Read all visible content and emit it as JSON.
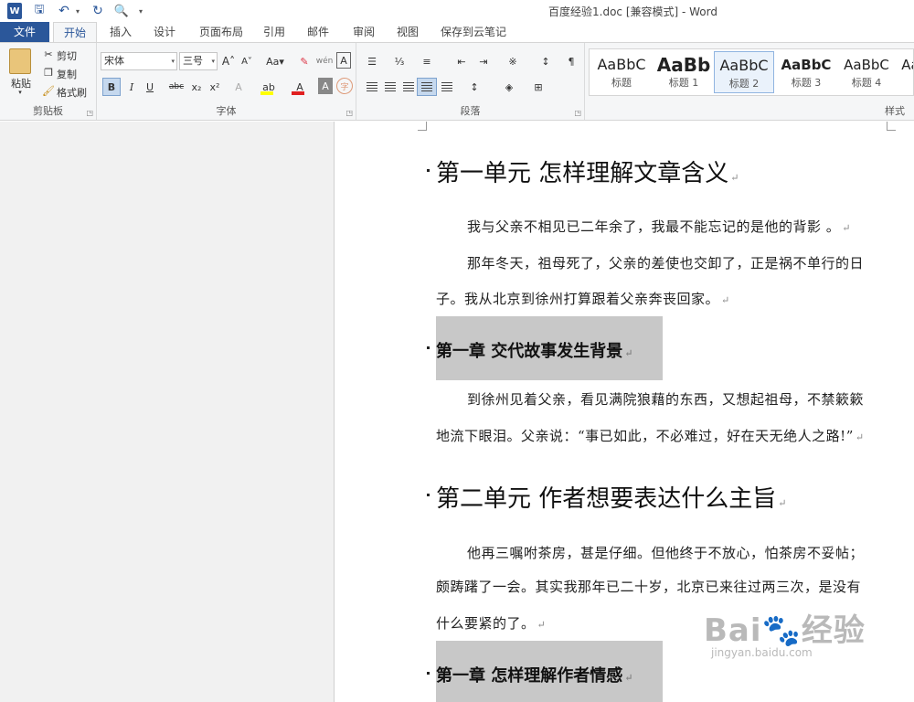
{
  "window": {
    "title": "百度经验1.doc [兼容模式] - Word",
    "logo": "W",
    "save_icon": "🖫",
    "undo_icon": "↶",
    "redo_icon": "↻",
    "preview_icon": "🔍",
    "dropdown": "▾"
  },
  "tabs": [
    "文件",
    "开始",
    "插入",
    "设计",
    "页面布局",
    "引用",
    "邮件",
    "审阅",
    "视图",
    "保存到云笔记"
  ],
  "ribbon": {
    "clipboard": {
      "label": "剪贴板",
      "paste": "粘贴",
      "cut": "剪切",
      "copy": "复制",
      "painter": "格式刷"
    },
    "font": {
      "label": "字体",
      "name": "宋体",
      "size": "三号",
      "grow": "A˄",
      "shrink": "A˅",
      "case": "Aa▾",
      "clear": "✎",
      "phonetic": "wén",
      "border_char": "A",
      "bold": "B",
      "italic": "I",
      "underline": "U",
      "strike": "abc",
      "sub": "x₂",
      "sup": "x²",
      "effect": "A",
      "highlight": "ab",
      "fontcolor": "A",
      "shade": "A",
      "enclose": "字"
    },
    "paragraph": {
      "label": "段落",
      "bullets": "☰",
      "numbering": "⅓",
      "multilevel": "≡",
      "decrease_indent": "⇤",
      "increase_indent": "⇥",
      "asian_layout": "※",
      "sort": "↕",
      "marks": "¶",
      "line_spacing": "↕",
      "shading": "◈",
      "borders": "⊞"
    },
    "styles": {
      "label": "样式",
      "items": [
        {
          "preview": "AaBbC",
          "name": "标题"
        },
        {
          "preview": "AaBb",
          "name": "标题 1"
        },
        {
          "preview": "AaBbC",
          "name": "标题 2"
        },
        {
          "preview": "AaBbC",
          "name": "标题 3"
        },
        {
          "preview": "AaBbC",
          "name": "标题 4"
        },
        {
          "preview": "Aa",
          "name": ""
        }
      ]
    }
  },
  "document": {
    "unit1_heading": "第一单元    怎样理解文章含义",
    "p1": "我与父亲不相见已二年余了，我最不能忘记的是他的背影 。",
    "p2_line1": "那年冬天，祖母死了，父亲的差使也交卸了，正是祸不单行的日",
    "p2_line2": "子。我从北京到徐州打算跟着父亲奔丧回家。",
    "chapter1_heading": "第一章    交代故事发生背景",
    "p3_line1": "到徐州见着父亲，看见满院狼藉的东西，又想起祖母，不禁簌簌",
    "p3_line2": "地流下眼泪。父亲说：“事已如此，不必难过，好在天无绝人之路!”",
    "unit2_heading": "第二单元    作者想要表达什么主旨",
    "p4_line1": "他再三嘱咐茶房，甚是仔细。但他终于不放心，怕茶房不妥帖；",
    "p4_line2": "颇踌躇了一会。其实我那年已二十岁，北京已来往过两三次，是没有",
    "p4_line3": "什么要紧的了。",
    "chapter2_heading": "第一章    怎样理解作者情感",
    "para_mark": "↵"
  },
  "watermark": {
    "brand": "Bai🐾经验",
    "url": "jingyan.baidu.com"
  }
}
